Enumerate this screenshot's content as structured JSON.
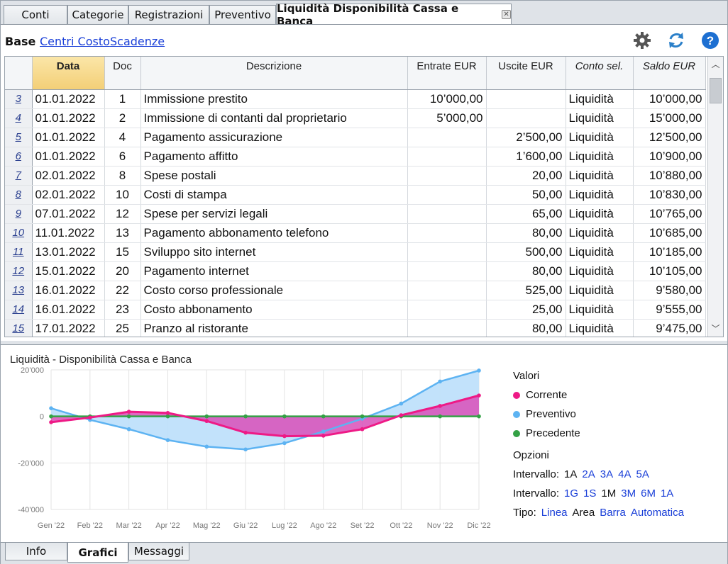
{
  "tabs": [
    {
      "label": "Conti"
    },
    {
      "label": "Categorie"
    },
    {
      "label": "Registrazioni"
    },
    {
      "label": "Preventivo"
    },
    {
      "label": "Liquidità Disponibilità Cassa e Banca",
      "active": true
    }
  ],
  "views": {
    "base": "Base",
    "centri": "Centri Costo",
    "scadenze": "Scadenze"
  },
  "toolbar": {
    "settings": "gear-icon",
    "refresh": "refresh-icon",
    "help": "help-icon"
  },
  "table": {
    "headers": {
      "data": "Data",
      "doc": "Doc",
      "descrizione": "Descrizione",
      "entrate": "Entrate EUR",
      "uscite": "Uscite EUR",
      "conto": "Conto sel.",
      "saldo": "Saldo EUR"
    },
    "rows": [
      {
        "n": "3",
        "data": "01.01.2022",
        "doc": "1",
        "desc": "Immissione prestito",
        "entrate": "10’000,00",
        "uscite": "",
        "conto": "Liquidità",
        "saldo": "10’000,00"
      },
      {
        "n": "4",
        "data": "01.01.2022",
        "doc": "2",
        "desc": "Immissione di contanti dal proprietario",
        "entrate": "5’000,00",
        "uscite": "",
        "conto": "Liquidità",
        "saldo": "15’000,00"
      },
      {
        "n": "5",
        "data": "01.01.2022",
        "doc": "4",
        "desc": "Pagamento assicurazione",
        "entrate": "",
        "uscite": "2’500,00",
        "conto": "Liquidità",
        "saldo": "12’500,00"
      },
      {
        "n": "6",
        "data": "01.01.2022",
        "doc": "6",
        "desc": "Pagamento affitto",
        "entrate": "",
        "uscite": "1’600,00",
        "conto": "Liquidità",
        "saldo": "10’900,00"
      },
      {
        "n": "7",
        "data": "02.01.2022",
        "doc": "8",
        "desc": "Spese postali",
        "entrate": "",
        "uscite": "20,00",
        "conto": "Liquidità",
        "saldo": "10’880,00"
      },
      {
        "n": "8",
        "data": "02.01.2022",
        "doc": "10",
        "desc": "Costi di stampa",
        "entrate": "",
        "uscite": "50,00",
        "conto": "Liquidità",
        "saldo": "10’830,00"
      },
      {
        "n": "9",
        "data": "07.01.2022",
        "doc": "12",
        "desc": "Spese per servizi legali",
        "entrate": "",
        "uscite": "65,00",
        "conto": "Liquidità",
        "saldo": "10’765,00"
      },
      {
        "n": "10",
        "data": "11.01.2022",
        "doc": "13",
        "desc": "Pagamento abbonamento telefono",
        "entrate": "",
        "uscite": "80,00",
        "conto": "Liquidità",
        "saldo": "10’685,00"
      },
      {
        "n": "11",
        "data": "13.01.2022",
        "doc": "15",
        "desc": "Sviluppo sito internet",
        "entrate": "",
        "uscite": "500,00",
        "conto": "Liquidità",
        "saldo": "10’185,00"
      },
      {
        "n": "12",
        "data": "15.01.2022",
        "doc": "20",
        "desc": "Pagamento internet",
        "entrate": "",
        "uscite": "80,00",
        "conto": "Liquidità",
        "saldo": "10’105,00"
      },
      {
        "n": "13",
        "data": "16.01.2022",
        "doc": "22",
        "desc": "Costo corso professionale",
        "entrate": "",
        "uscite": "525,00",
        "conto": "Liquidità",
        "saldo": "9’580,00"
      },
      {
        "n": "14",
        "data": "16.01.2022",
        "doc": "23",
        "desc": "Costo abbonamento",
        "entrate": "",
        "uscite": "25,00",
        "conto": "Liquidità",
        "saldo": "9’555,00"
      },
      {
        "n": "15",
        "data": "17.01.2022",
        "doc": "25",
        "desc": "Pranzo al ristorante",
        "entrate": "",
        "uscite": "80,00",
        "conto": "Liquidità",
        "saldo": "9’475,00"
      }
    ]
  },
  "chart_data": {
    "type": "area",
    "title": "Liquidità - Disponibilità Cassa e Banca",
    "categories": [
      "Gen '22",
      "Feb '22",
      "Mar '22",
      "Apr '22",
      "Mag '22",
      "Giu '22",
      "Lug '22",
      "Ago '22",
      "Set '22",
      "Ott '22",
      "Nov '22",
      "Dic '22"
    ],
    "ylim": [
      -40000,
      20000
    ],
    "yticks": [
      "20’000",
      "0",
      "-20’000",
      "-40’000"
    ],
    "ytick_values": [
      20000,
      0,
      -20000,
      -40000
    ],
    "grid": true,
    "series": [
      {
        "name": "Corrente",
        "color": "#ee1a86",
        "values": [
          -2500,
          -500,
          2000,
          1500,
          -2000,
          -7000,
          -8500,
          -8300,
          -5500,
          500,
          4500,
          9000
        ]
      },
      {
        "name": "Preventivo",
        "color": "#5db3f2",
        "values": [
          3500,
          -1500,
          -5500,
          -10200,
          -13000,
          -14200,
          -11500,
          -6500,
          -1000,
          5500,
          15000,
          19700
        ]
      },
      {
        "name": "Precedente",
        "color": "#33a145",
        "values": [
          0,
          0,
          0,
          0,
          0,
          0,
          0,
          0,
          0,
          0,
          0,
          0
        ]
      }
    ]
  },
  "legend": {
    "header": "Valori",
    "options_header": "Opzioni"
  },
  "options": {
    "intervallo1_label": "Intervallo:",
    "intervallo1": [
      {
        "t": "1A",
        "sel": true
      },
      {
        "t": "2A"
      },
      {
        "t": "3A"
      },
      {
        "t": "4A"
      },
      {
        "t": "5A"
      }
    ],
    "intervallo2_label": "Intervallo:",
    "intervallo2": [
      {
        "t": "1G"
      },
      {
        "t": "1S"
      },
      {
        "t": "1M",
        "sel": true
      },
      {
        "t": "3M"
      },
      {
        "t": "6M"
      },
      {
        "t": "1A"
      }
    ],
    "tipo_label": "Tipo:",
    "tipo": [
      {
        "t": "Linea"
      },
      {
        "t": "Area",
        "sel": true
      },
      {
        "t": "Barra"
      },
      {
        "t": "Automatica"
      }
    ]
  },
  "bottom_tabs": [
    {
      "label": "Info"
    },
    {
      "label": "Grafici",
      "active": true
    },
    {
      "label": "Messaggi"
    }
  ]
}
